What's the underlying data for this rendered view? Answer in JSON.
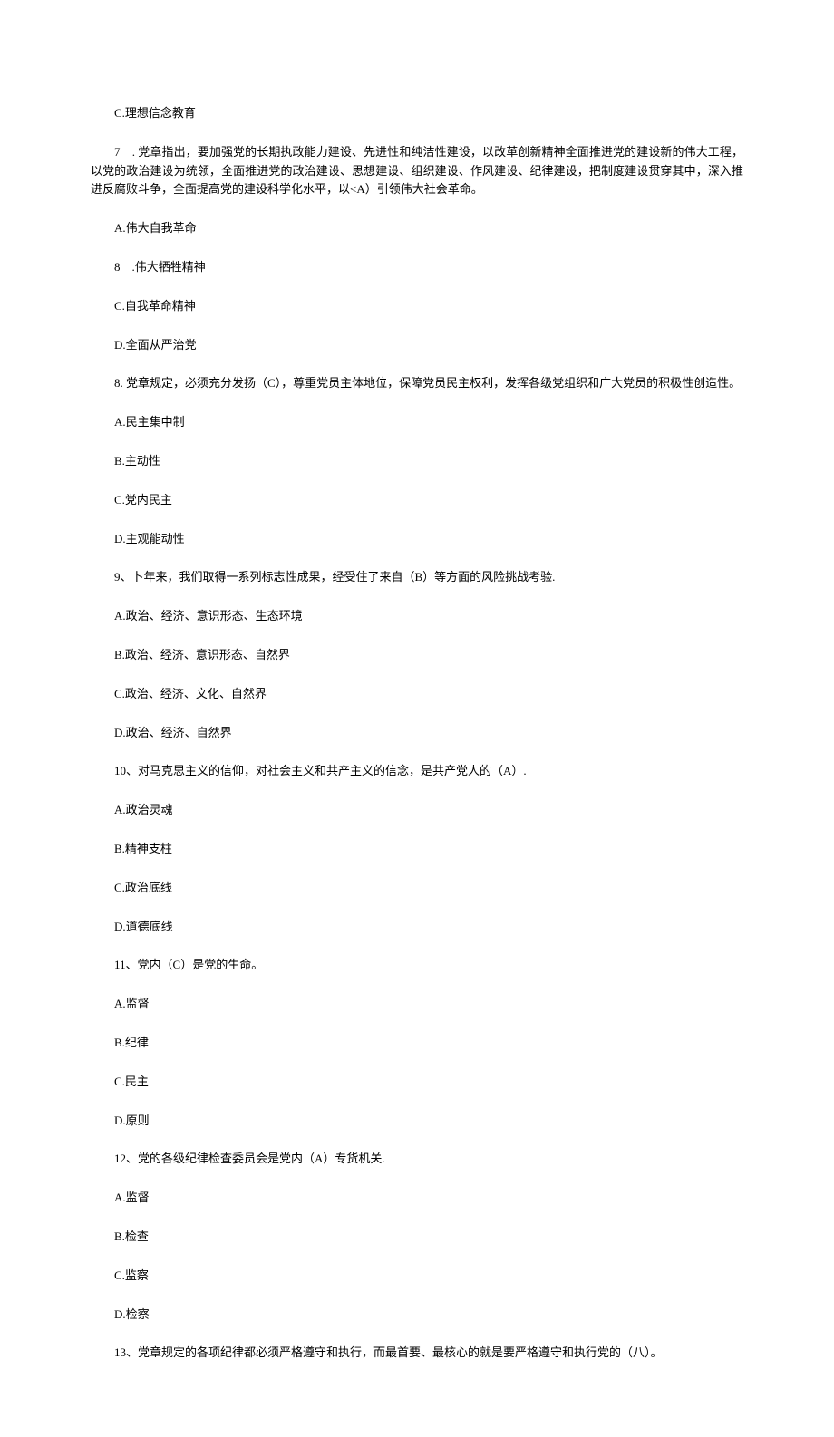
{
  "lines": [
    "C.理想信念教育",
    "7　. 党章指出，要加强党的长期执政能力建设、先进性和纯洁性建设，以改革创新精神全面推进党的建设新的伟大工程，以党的政治建设为统领，全面推进党的政治建设、思想建设、组织建设、作风建设、纪律建设，把制度建设贯穿其中，深入推进反腐败斗争，全面提高党的建设科学化水平，以<A）引领伟大社会革命。",
    "A.伟大自我革命",
    "8　.伟大牺牲精神",
    "C.自我革命精神",
    "D.全面从严治党",
    "8. 党章规定，必须充分发扬（C），尊重党员主体地位，保障党员民主权利，发挥各级党组织和广大党员的积极性创造性。",
    "A.民主集中制",
    "B.主动性",
    "C.党内民主",
    "D.主观能动性",
    "9、卜年来，我们取得一系列标志性成果，经受住了来自（B）等方面的风险挑战考验.",
    "A.政治、经济、意识形态、生态环境",
    "B.政治、经济、意识形态、自然界",
    "C.政治、经济、文化、自然界",
    "D.政治、经济、自然界",
    "10、对马克思主义的信仰，对社会主义和共产主义的信念，是共产党人的（A）.",
    "A.政治灵魂",
    "B.精神支柱",
    "C.政治底线",
    "D.道德底线",
    "11、党内（C）是党的生命。",
    "A.监督",
    "B.纪律",
    "C.民主",
    "D.原则",
    "12、党的各级纪律检查委员会是党内（A）专货机关.",
    "A.监督",
    "B.检查",
    "C.监察",
    "D.检察",
    "13、党章规定的各项纪律都必须严格遵守和执行，而最首要、最核心的就是要严格遵守和执行党的（八）。"
  ]
}
